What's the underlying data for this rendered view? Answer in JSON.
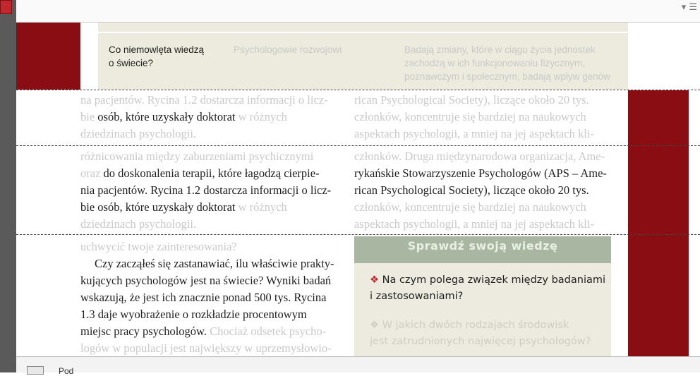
{
  "toolbar": {
    "menu_glyph": "▾ ☰"
  },
  "status_bar": {
    "label": "Pod"
  },
  "table_row": {
    "question_lines": [
      "Co niemowlęta wiedzą",
      "o świecie?"
    ],
    "group_label": "Psychologowie rozwojowi",
    "description_lines": [
      "Badają zmiany, które w ciągu życia jednostek",
      "zachodzą w ich funkcjonowaniu fizycznym,",
      "poznawczym i społecznym; badają wpływ genów"
    ]
  },
  "strip1": {
    "left": [
      {
        "t": "na pacjentów. Rycina 1.2 dostarcza informacji o licz-",
        "c": "light"
      },
      {
        "t": "bie osób, które uzyskały doktorat w różnych",
        "c": "mixed1"
      },
      {
        "t": "dziedzinach psychologii.",
        "c": "light"
      }
    ],
    "right": [
      "rican Psychological Society), liczące około 20 tys.",
      "członków, koncentruje się bardziej na naukowych",
      "aspektach psychologii, a mniej na jej aspektach kli-"
    ],
    "mixed1": {
      "a": "bie ",
      "b": "osób, które uzyskały doktorat",
      "c": " w różnych"
    }
  },
  "strip2": {
    "left": {
      "l1": "różnicowania między zaburzeniami psychicznymi",
      "l2a": "oraz ",
      "l2b": "do doskonalenia terapii, które łagodzą cierpie-",
      "l3": "nia pacjentów. Rycina 1.2 dostarcza informacji o licz-",
      "l4a": "bie osób, które uzyskały doktorat",
      "l4b": " w różnych",
      "l5": "dziedzinach psychologii."
    },
    "right": {
      "l1": "członków. Druga międzynarodowa organizacja, Ame-",
      "l2": "rykańskie Stowarzyszenie Psychologów (APS – Ame-",
      "l3": "rican Psychological Society), liczące około 20 tys.",
      "l4": "członków, koncentruje się bardziej na naukowych",
      "l5": "aspektach psychologii, a mniej na jej aspektach kli-"
    }
  },
  "strip3": {
    "l0": "uchwycić twoje zainteresowania?",
    "l1": "Czy zacząłeś się zastanawiać, ilu właściwie prakty-",
    "l2": "kujących psychologów jest na świecie? Wyniki badań",
    "l3": "wskazują, że jest ich znacznie ponad 500 tys. Rycina",
    "l4": "1.3 daje wyobrażenie o rozkładzie procentowym",
    "l5a": "miejsc pracy psychologów.",
    "l5b": " Chociaż odsetek psycho-",
    "l6": "logów w populacji jest największy w uprzemysłowio-"
  },
  "quiz": {
    "title": "Sprawdź swoją wiedzę",
    "bullet": "❖",
    "q1_lines": [
      "Na czym polega związek między badaniami",
      "i zastosowaniami?"
    ],
    "q2_lines": [
      "W jakich dwóch rodzajach środowisk",
      "jest zatrudnionych najwięcej psychologów?"
    ]
  },
  "colors": {
    "accent_red": "#8b0d14",
    "quiz_header": "#a9b6a1",
    "quiz_body": "#edebdf",
    "table_bg": "#ecebdd"
  }
}
